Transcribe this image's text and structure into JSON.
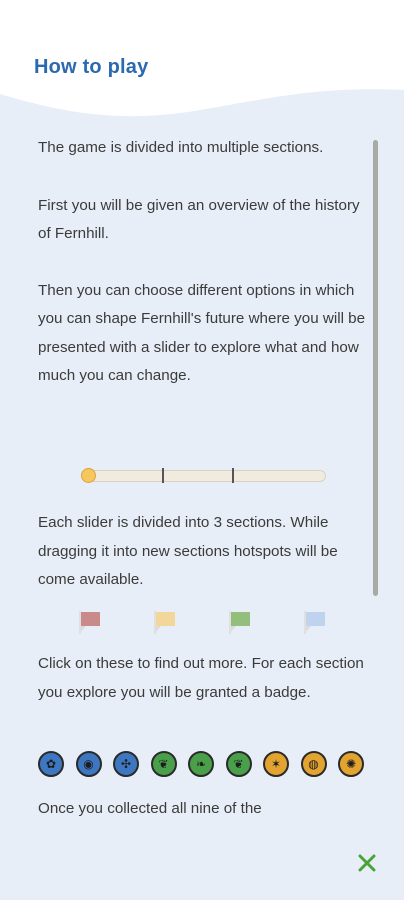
{
  "header": {
    "title": "How to play"
  },
  "content": {
    "p1": "The game is divided into multiple sections.",
    "p2": "First you will be given an overview of the history of Fernhill.",
    "p3": "Then you can choose different options in which you can shape Fernhill's future where you will be presented with a slider to explore what and how much you can change.",
    "p4": "Each slider is divided into 3 sections. While dragging it into new sections hotspots will be come available.",
    "p5": "Click on these to find out more. For each section you explore you will be granted a badge.",
    "p6": "Once you collected all nine of the"
  },
  "slider": {
    "position": 0.0,
    "sections": 3
  },
  "hotspots": [
    {
      "name": "red-hotspot-icon",
      "color": "#c98a8a"
    },
    {
      "name": "yellow-hotspot-icon",
      "color": "#f3d79a"
    },
    {
      "name": "green-hotspot-icon",
      "color": "#93be7c"
    },
    {
      "name": "blue-hotspot-icon",
      "color": "#bfd3ee"
    }
  ],
  "badges": [
    {
      "name": "blue-badge-1-icon",
      "color": "#3d77c2"
    },
    {
      "name": "blue-badge-2-icon",
      "color": "#3d77c2"
    },
    {
      "name": "blue-badge-3-icon",
      "color": "#3d77c2"
    },
    {
      "name": "green-badge-1-icon",
      "color": "#4aa04a"
    },
    {
      "name": "green-badge-2-icon",
      "color": "#4aa04a"
    },
    {
      "name": "green-badge-3-icon",
      "color": "#4aa04a"
    },
    {
      "name": "orange-badge-1-icon",
      "color": "#e3a330"
    },
    {
      "name": "orange-badge-2-icon",
      "color": "#e3a330"
    },
    {
      "name": "orange-badge-3-icon",
      "color": "#e3a330"
    }
  ],
  "colors": {
    "accent": "#2b69b0",
    "background": "#e8eef7",
    "close": "#4aa337"
  },
  "icons": {
    "close": "close-icon"
  }
}
